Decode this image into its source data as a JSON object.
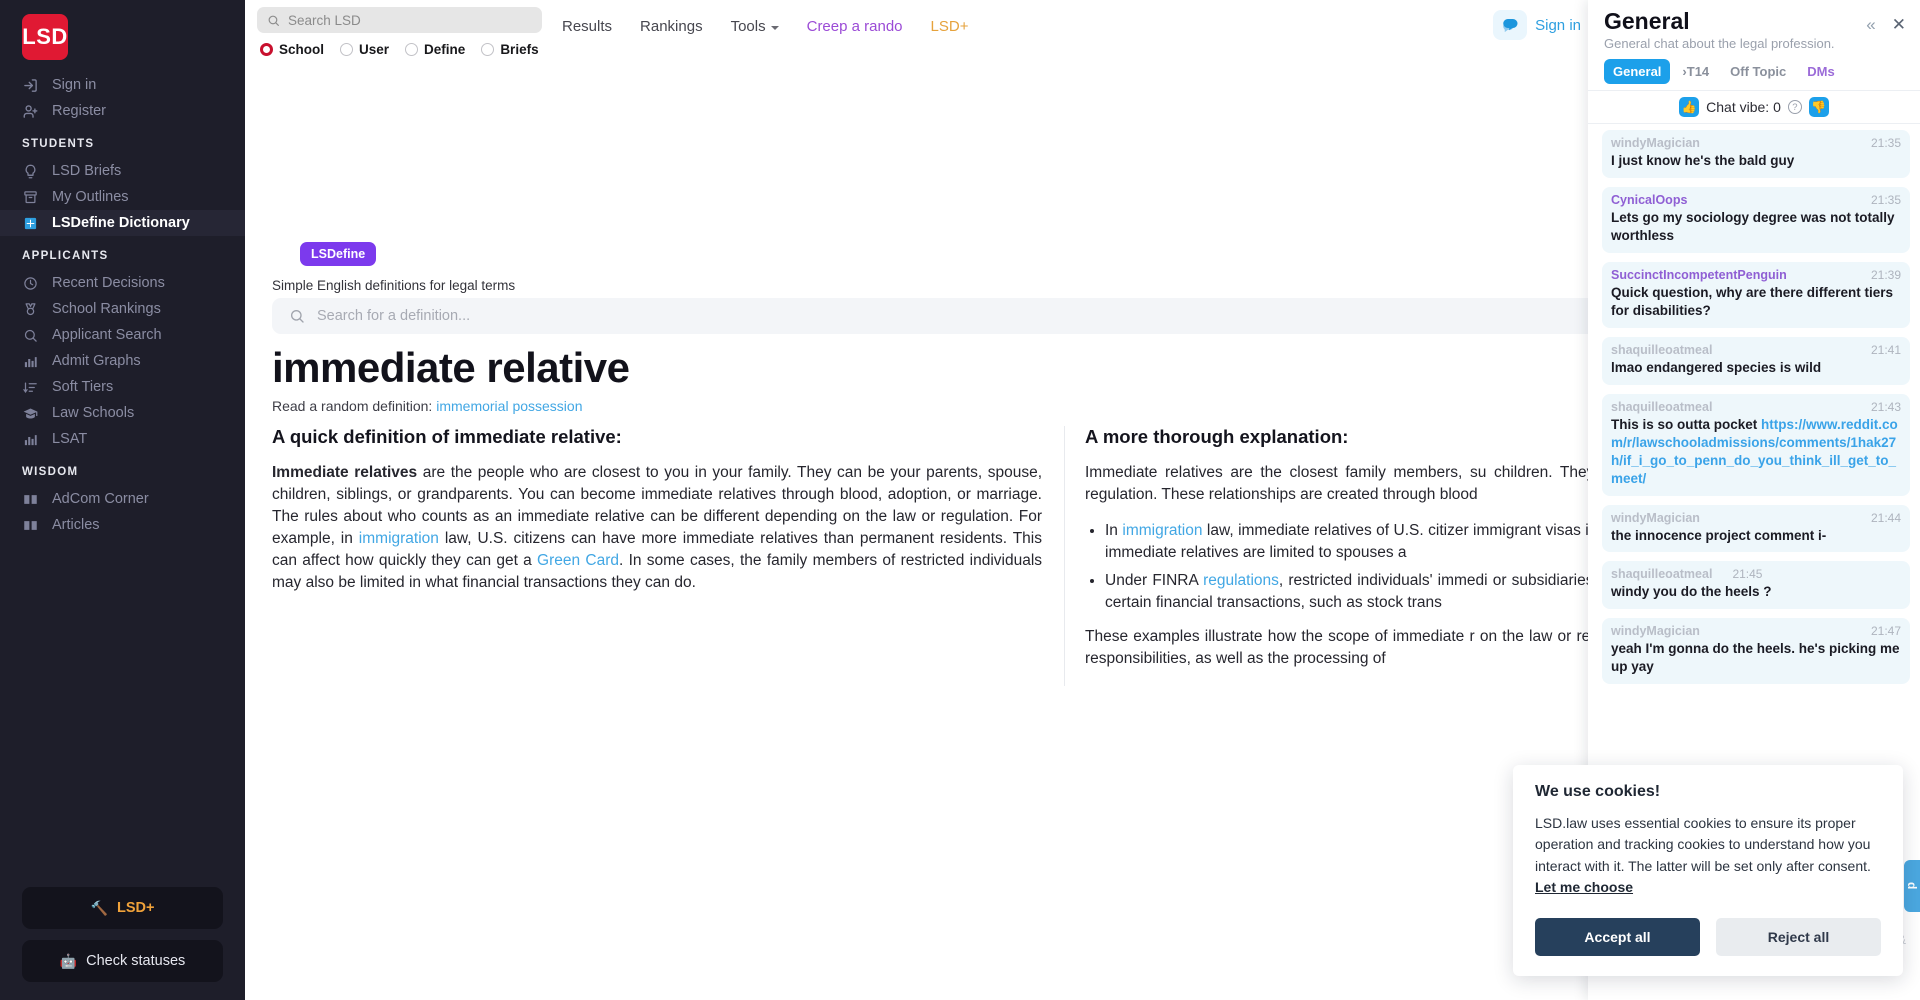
{
  "sidebar": {
    "logo": "LSD",
    "auth": [
      {
        "label": "Sign in",
        "icon": "sign-in-icon"
      },
      {
        "label": "Register",
        "icon": "user-plus-icon"
      }
    ],
    "groups": [
      {
        "title": "STUDENTS",
        "items": [
          {
            "label": "LSD Briefs",
            "icon": "lightbulb-icon",
            "active": false
          },
          {
            "label": "My Outlines",
            "icon": "archive-icon",
            "active": false
          },
          {
            "label": "LSDefine Dictionary",
            "icon": "book-icon",
            "active": true
          }
        ]
      },
      {
        "title": "APPLICANTS",
        "items": [
          {
            "label": "Recent Decisions",
            "icon": "clock-icon",
            "active": false
          },
          {
            "label": "School Rankings",
            "icon": "medal-icon",
            "active": false
          },
          {
            "label": "Applicant Search",
            "icon": "search-icon",
            "active": false
          },
          {
            "label": "Admit Graphs",
            "icon": "bar-chart-icon",
            "active": false
          },
          {
            "label": "Soft Tiers",
            "icon": "sort-icon",
            "active": false
          },
          {
            "label": "Law Schools",
            "icon": "graduation-cap-icon",
            "active": false
          },
          {
            "label": "LSAT",
            "icon": "bar-chart-icon",
            "active": false
          }
        ]
      },
      {
        "title": "WISDOM",
        "items": [
          {
            "label": "AdCom Corner",
            "icon": "open-book-icon",
            "active": false
          },
          {
            "label": "Articles",
            "icon": "open-book-icon",
            "active": false
          }
        ]
      }
    ],
    "bottom_buttons": [
      {
        "label": "LSD+",
        "emoji": "🔨",
        "kind": "lsdplus"
      },
      {
        "label": "Check statuses",
        "emoji": "🤖",
        "kind": "statuses"
      }
    ]
  },
  "topbar": {
    "search_placeholder": "Search LSD",
    "search_value": "",
    "search_icon": "search-icon",
    "radios": [
      {
        "label": "School",
        "selected": true
      },
      {
        "label": "User",
        "selected": false
      },
      {
        "label": "Define",
        "selected": false
      },
      {
        "label": "Briefs",
        "selected": false
      }
    ],
    "links": [
      {
        "label": "Results",
        "style": "default",
        "caret": false
      },
      {
        "label": "Rankings",
        "style": "default",
        "caret": false
      },
      {
        "label": "Tools",
        "style": "default",
        "caret": true
      },
      {
        "label": "Creep a rando",
        "style": "creep",
        "caret": false
      },
      {
        "label": "LSD+",
        "style": "plus",
        "caret": false
      }
    ],
    "chat_toggle_icon": "chat-bubble-icon",
    "signin_label": "Sign in"
  },
  "define": {
    "badge": "LSDefine",
    "subtitle": "Simple English definitions for legal terms",
    "search_placeholder": "Search for a definition...",
    "search_value": "",
    "term": "immediate relative",
    "random_prefix": "Read a random definition:",
    "random_link": "immemorial possession",
    "quick": {
      "heading": "A quick definition of immediate relative:",
      "lead": "Immediate relatives",
      "body_1": " are the people who are closest to you in your family. They can be your parents, spouse, children, siblings, or grandparents. You can become immediate relatives through blood, adoption, or marriage. The rules about who counts as an immediate relative can be different depending on the law or regulation. For example, in ",
      "link_1": "immigration",
      "body_2": " law, U.S. citizens can have more immediate relatives than permanent residents. This can affect how quickly they can get a ",
      "link_2": "Green Card",
      "body_3": ". In some cases, the family members of restricted individuals may also be limited in what financial transactions they can do."
    },
    "thorough": {
      "heading": "A more thorough explanation:",
      "intro": "Immediate relatives are the closest family members, su children. They can also include siblings and grandparer regulation. These relationships are created through blood",
      "bullet_1_pre": "In ",
      "bullet_1_link": "immigration",
      "bullet_1_post": " law, immediate relatives of U.S. citizer immigrant visas include spouses, children, parents, residents, immediate relatives are limited to spouses a",
      "bullet_2_pre": "Under FINRA ",
      "bullet_2_link": "regulations",
      "bullet_2_post": ", restricted individuals' immedi or subsidiaries of them or their parents. These family from certain financial transactions, such as stock trans",
      "closing": "These examples illustrate how the scope of immediate r on the law or regulation. The definition of immediate rel and responsibilities, as well as the processing of"
    }
  },
  "chat": {
    "title": "General",
    "subtitle": "General chat about the legal profession.",
    "collapse_icon": "chevron-double-left-icon",
    "close_icon": "close-icon",
    "tabs": [
      {
        "label": "General",
        "active": true,
        "style": "active"
      },
      {
        "label": "›T14",
        "active": false,
        "style": "default"
      },
      {
        "label": "Off Topic",
        "active": false,
        "style": "default"
      },
      {
        "label": "DMs",
        "active": false,
        "style": "dms"
      }
    ],
    "vibe": {
      "label": "Chat vibe: 0",
      "up": "👍",
      "down": "👎",
      "help": "?"
    },
    "messages": [
      {
        "user": "windyMagician",
        "user_style": "gray",
        "time": "21:35",
        "text": "I just know he's the bald guy"
      },
      {
        "user": "CynicalOops",
        "user_style": "purple",
        "time": "21:35",
        "text": "Lets go my sociology degree was not totally worthless"
      },
      {
        "user": "SuccinctIncompetentPenguin",
        "user_style": "purple",
        "time": "21:39",
        "text": "Quick question, why are there different tiers for disabilities?"
      },
      {
        "user": "shaquilleoatmeal",
        "user_style": "gray",
        "time": "21:41",
        "text": "lmao endangered species is wild"
      },
      {
        "user": "shaquilleoatmeal",
        "user_style": "gray",
        "time": "21:43",
        "text": "This is so outta pocket ",
        "url": "https://www.reddit.com/r/lawschooladmissions/comments/1hak27h/if_i_go_to_penn_do_you_think_ill_get_to_meet/"
      },
      {
        "user": "windyMagician",
        "user_style": "gray",
        "time": "21:44",
        "text": "the innocence project comment i-"
      },
      {
        "user": "shaquilleoatmeal",
        "user_style": "gray",
        "time": "21:45",
        "text": "windy you do the heels ?",
        "tight_time": true
      },
      {
        "user": "windyMagician",
        "user_style": "gray",
        "time": "21:47",
        "text": "yeah I'm gonna do the heels. he's picking me up yay"
      }
    ]
  },
  "cookie": {
    "title": "We use cookies!",
    "body": "LSD.law uses essential cookies to ensure its proper operation and tracking cookies to understand how you interact with it. The latter will be set only after consent. ",
    "choose_label": "Let me choose",
    "accept_label": "Accept all",
    "reject_label": "Reject all"
  },
  "edge": {
    "feedback_label": "d",
    "ghost": "&"
  }
}
